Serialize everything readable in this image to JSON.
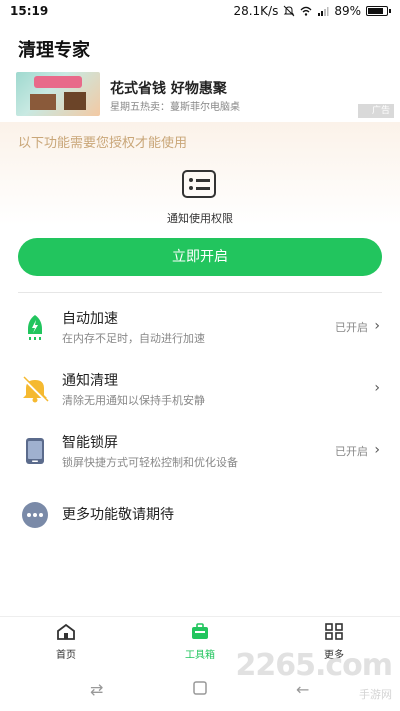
{
  "status_bar": {
    "time": "15:19",
    "network_speed": "28.1K/s",
    "battery": "89%",
    "battery_level": 0.89
  },
  "app": {
    "title": "清理专家"
  },
  "ad": {
    "title": "花式省钱 好物惠聚",
    "subtitle": "星期五热卖：蔓斯菲尔电脑桌",
    "tag": "广告"
  },
  "auth": {
    "notice": "以下功能需要您授权才能使用",
    "permission_label": "通知使用权限",
    "enable_button": "立即开启"
  },
  "features": [
    {
      "title": "自动加速",
      "desc": "在内存不足时，自动进行加速",
      "status": "已开启",
      "icon": "rocket-icon",
      "color": "#22c55e"
    },
    {
      "title": "通知清理",
      "desc": "清除无用通知以保持手机安静",
      "status": "",
      "icon": "muted-bell-icon",
      "color": "#f5b930"
    },
    {
      "title": "智能锁屏",
      "desc": "锁屏快捷方式可轻松控制和优化设备",
      "status": "已开启",
      "icon": "phone-icon",
      "color": "#5b6b8c"
    },
    {
      "title": "更多功能敬请期待",
      "desc": "",
      "status": "",
      "icon": "more-dots-icon",
      "color": "#7a8aa8"
    }
  ],
  "bottom_nav": [
    {
      "label": "首页",
      "icon": "home-icon"
    },
    {
      "label": "工具箱",
      "icon": "toolbox-icon",
      "active": true
    },
    {
      "label": "更多",
      "icon": "grid-icon"
    }
  ],
  "watermark": {
    "main": "2265.com",
    "sub": "手游网"
  },
  "colors": {
    "accent": "#22c55e",
    "notice": "#c9a678"
  }
}
